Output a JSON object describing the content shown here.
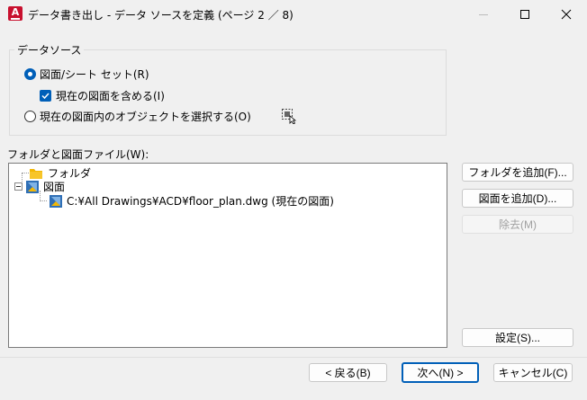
{
  "window": {
    "title": "データ書き出し - データ ソースを定義 (ページ 2 ／ 8)",
    "app_icon_letter": "A"
  },
  "data_source": {
    "legend": "データソース",
    "radio_sheet_set": {
      "label": "図面/シート セット(R)",
      "selected": true
    },
    "include_current": {
      "label": "現在の図面を含める(I)",
      "checked": true
    },
    "radio_select_objects": {
      "label": "現在の図面内のオブジェクトを選択する(O)",
      "selected": false
    }
  },
  "files": {
    "label": "フォルダと図面ファイル(W):",
    "tree": [
      {
        "label": "フォルダ",
        "icon": "folder-icon"
      },
      {
        "label": "図面",
        "icon": "drawing-icon"
      },
      {
        "label": "C:¥All Drawings¥ACD¥floor_plan.dwg (現在の図面)",
        "icon": "dwg-file-icon"
      }
    ]
  },
  "side_buttons": {
    "add_folder": "フォルダを追加(F)...",
    "add_drawing": "図面を追加(D)...",
    "remove": "除去(M)",
    "settings": "設定(S)..."
  },
  "nav_buttons": {
    "back": "< 戻る(B)",
    "next": "次へ(N) >",
    "cancel": "キャンセル(C)"
  },
  "colors": {
    "accent": "#005fb8",
    "app_red": "#c8102e",
    "folder_yellow": "#f2b705"
  }
}
